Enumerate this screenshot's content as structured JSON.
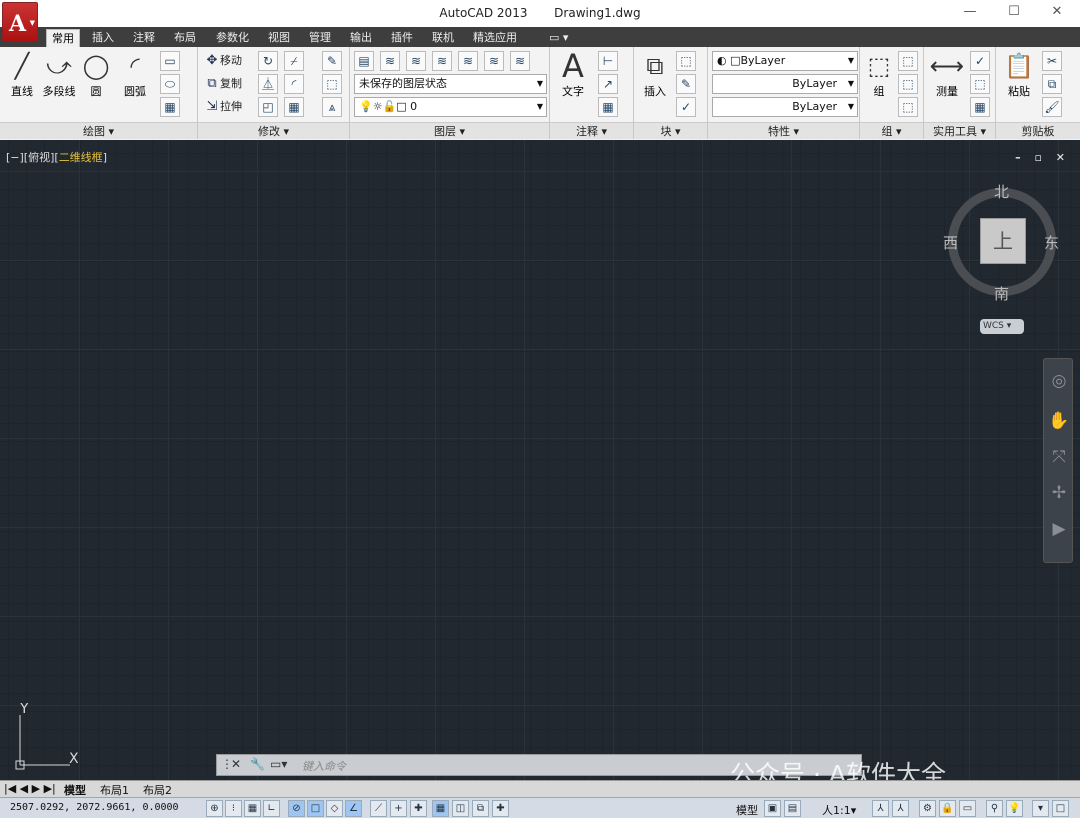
{
  "window": {
    "title": "AutoCAD 2013",
    "file": "Drawing1.dwg",
    "minimize": "—",
    "maximize": "☐",
    "close": "✕"
  },
  "tabs": [
    "常用",
    "插入",
    "注释",
    "布局",
    "参数化",
    "视图",
    "管理",
    "输出",
    "插件",
    "联机",
    "精选应用"
  ],
  "draw": {
    "line": "直线",
    "polyline": "多段线",
    "circle": "圆",
    "arc": "圆弧",
    "title": "绘图 ▾"
  },
  "modify": {
    "move": "移动",
    "copy": "复制",
    "stretch": "拉伸",
    "title": "修改 ▾"
  },
  "layers": {
    "state": "未保存的图层状态",
    "current": "0",
    "title": "图层 ▾"
  },
  "annotation": {
    "text": "文字",
    "title": "注释 ▾"
  },
  "block": {
    "insert": "插入",
    "title": "块 ▾"
  },
  "properties": {
    "color": "ByLayer",
    "linetype": "ByLayer",
    "lineweight": "ByLayer",
    "title": "特性 ▾"
  },
  "groups": {
    "group": "组",
    "title": "组 ▾"
  },
  "utilities": {
    "measure": "测量",
    "title": "实用工具 ▾"
  },
  "clipboard": {
    "paste": "粘贴",
    "title": "剪贴板"
  },
  "viewport": {
    "label_prefix": "[−][俯视][",
    "visual_style": "二维线框",
    "label_suffix": "]",
    "controls": "– ▫ ✕"
  },
  "viewcube": {
    "north": "北",
    "south": "南",
    "east": "东",
    "west": "西",
    "face": "上",
    "wcs": "WCS ▾"
  },
  "ucs": {
    "x": "X",
    "y": "Y"
  },
  "command": {
    "placeholder": "键入命令"
  },
  "layout_tabs": {
    "nav": "|◀ ◀ ▶ ▶|",
    "model": "模型",
    "layout1": "布局1",
    "layout2": "布局2"
  },
  "status": {
    "coords": "2507.0292,  2072.9661,  0.0000",
    "model": "模型",
    "scale": "人1:1▾"
  },
  "watermark": "公众号 · A软件大全"
}
